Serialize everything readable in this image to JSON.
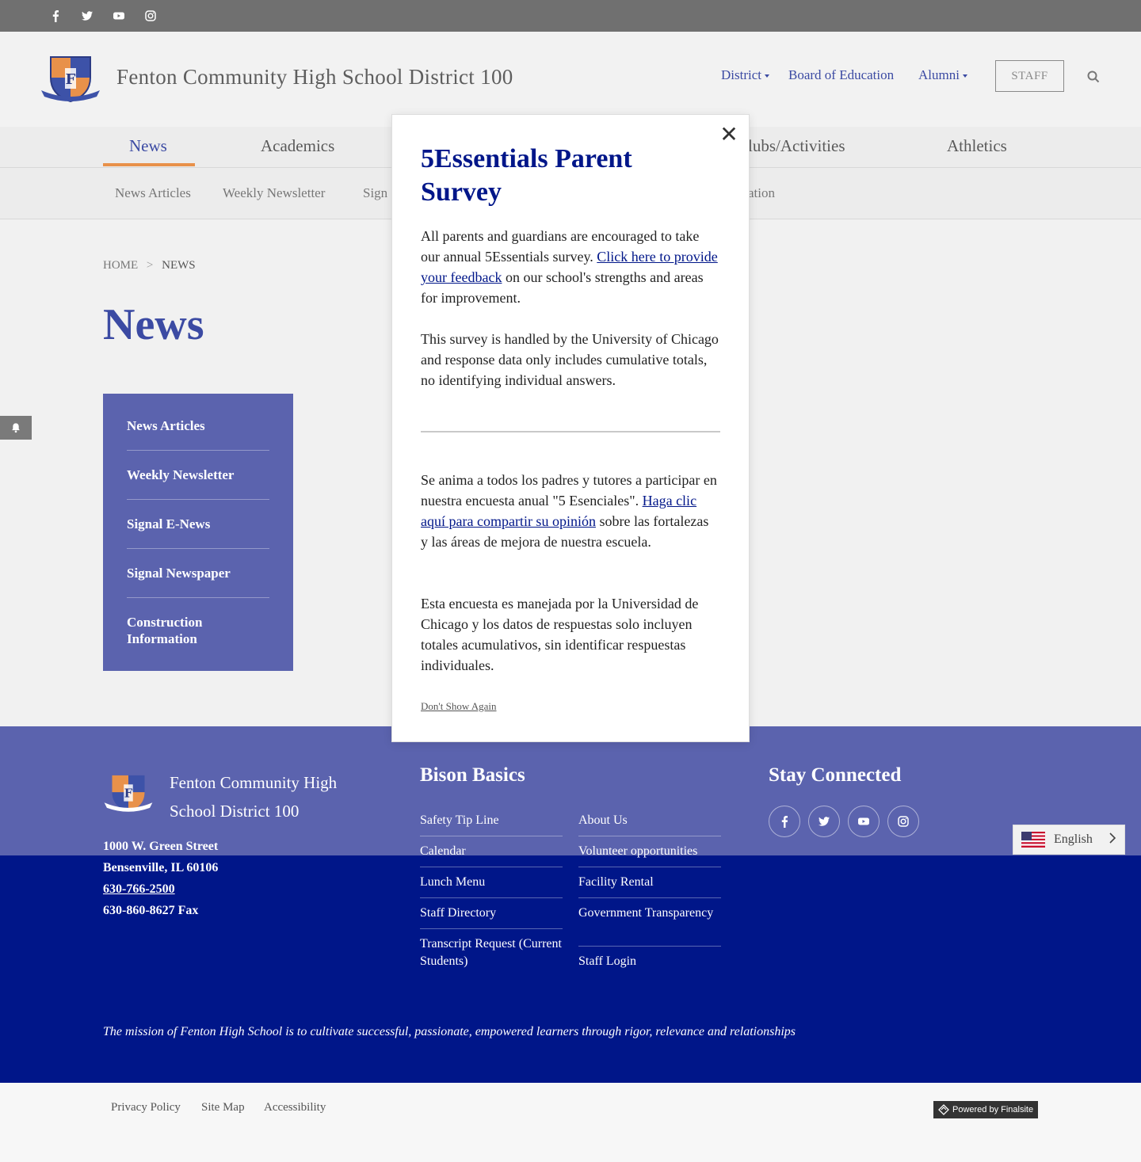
{
  "social": {
    "icons": [
      "facebook-icon",
      "twitter-icon",
      "youtube-icon",
      "instagram-icon"
    ]
  },
  "header": {
    "site_title": "Fenton Community High School District 100",
    "nav": [
      {
        "label": "District",
        "dropdown": true
      },
      {
        "label": "Board of Education",
        "dropdown": false
      },
      {
        "label": "Alumni",
        "dropdown": true
      }
    ],
    "staff_label": "STAFF"
  },
  "main_nav": {
    "tabs": [
      "News",
      "Academics",
      "lubs/Activities",
      "Athletics"
    ],
    "active": "News"
  },
  "sub_nav": {
    "tabs": [
      "News Articles",
      "Weekly Newsletter",
      "Sign",
      "ation"
    ]
  },
  "breadcrumb": {
    "home": "HOME",
    "separator": ">",
    "current": "NEWS"
  },
  "page_title": "News",
  "side_nav": {
    "items": [
      "News Articles",
      "Weekly Newsletter",
      "Signal E-News",
      "Signal Newspaper",
      "Construction Information"
    ]
  },
  "modal": {
    "title": "5Essentials Parent Survey",
    "close_label": "✕",
    "en_p1_before": "All parents and guardians are encouraged to take our annual 5Essentials survey. ",
    "en_p1_link": "Click here to provide your feedback",
    "en_p1_after": " on our school's strengths and areas for improvement.",
    "en_p2": "This survey is handled by the University of Chicago and response data only includes cumulative totals, no identifying individual answers.",
    "es_p1_before": "Se anima a todos los padres y tutores a participar en nuestra encuesta anual \"5 Esenciales\". ",
    "es_p1_link": "Haga clic aquí para compartir su opinión",
    "es_p1_after": " sobre las fortalezas y las áreas de mejora de nuestra escuela.",
    "es_p2": "Esta encuesta es manejada por la Universidad de Chicago y los datos de respuestas solo incluyen totales acumulativos, sin identificar respuestas individuales.",
    "dont_show": "Don't Show Again"
  },
  "footer": {
    "school_name": "Fenton Community High School District 100",
    "address_line1": "1000 W. Green Street",
    "address_line2": "Bensenville, IL  60106",
    "phone": "630-766-2500",
    "fax": "630-860-8627 Fax",
    "bison_heading": "Bison Basics",
    "links_col1": [
      "Safety Tip Line",
      "Calendar",
      "Lunch Menu",
      "Staff Directory",
      "Transcript Request (Current Students)"
    ],
    "links_col2": [
      "About Us",
      "Volunteer opportunities",
      "Facility Rental",
      "Government Transparency",
      "Staff Login"
    ],
    "stay_heading": "Stay Connected",
    "language": "English",
    "mission": "The mission of Fenton High School is to cultivate successful, passionate, empowered learners through rigor, relevance and relationships"
  },
  "bottom": {
    "links": [
      "Privacy Policy",
      "Site Map",
      "Accessibility"
    ],
    "powered": "Powered by Finalsite"
  },
  "colors": {
    "primary": "#3b4aa3",
    "navy": "#001689",
    "accent": "#e8914a",
    "sidenav": "#5b63ae"
  }
}
